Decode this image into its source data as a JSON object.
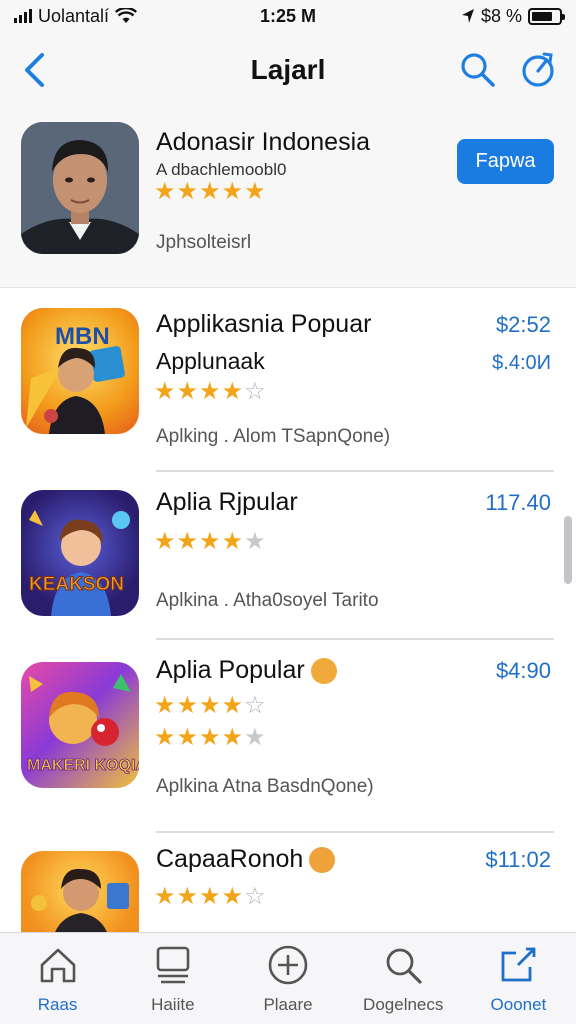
{
  "status_bar": {
    "carrier": "Uolantalí",
    "time": "1:25 M",
    "battery_text": "$8 %",
    "battery_level": 0.75
  },
  "nav": {
    "title": "Lajarl"
  },
  "featured": {
    "title": "Adonasir Indonesia",
    "subtitle": "A dbachlemoobl0",
    "rating": 5,
    "developer": "Jphsolteisrl",
    "button_label": "Fapwa"
  },
  "apps": [
    {
      "name": "Applikasnia Popuar",
      "price": "$2:52",
      "subtitle": "Applunaak",
      "price2": "$.4:0И",
      "rating": 4,
      "meta": "Aplking . Alom TSapnQone)",
      "icon_text": "MBN"
    },
    {
      "name": "Aplia Rjpular",
      "price": "117.40",
      "rating": 4,
      "meta": "Aplkina . Atha0soyel Tarito",
      "icon_text": "KEAKSON"
    },
    {
      "name": "Aplia Popular",
      "price": "$4:90",
      "rating": 4,
      "rating2": 4,
      "meta": "Aplkina  Atna  BasdnQone)",
      "icon_text": "MAKERI KOQIAA"
    },
    {
      "name": "CapaaRonoh",
      "price": "$11:02",
      "rating": 4
    }
  ],
  "tabs": [
    {
      "label": "Raas",
      "icon": "home-icon"
    },
    {
      "label": "Haiite",
      "icon": "apps-icon"
    },
    {
      "label": "Plaare",
      "icon": "plus-circle-icon"
    },
    {
      "label": "Dogelnecs",
      "icon": "search-icon"
    },
    {
      "label": "Ooonet",
      "icon": "share-icon"
    }
  ],
  "colors": {
    "accent": "#1f6fc9",
    "button": "#1a7ce0",
    "star": "#f3a51a"
  }
}
